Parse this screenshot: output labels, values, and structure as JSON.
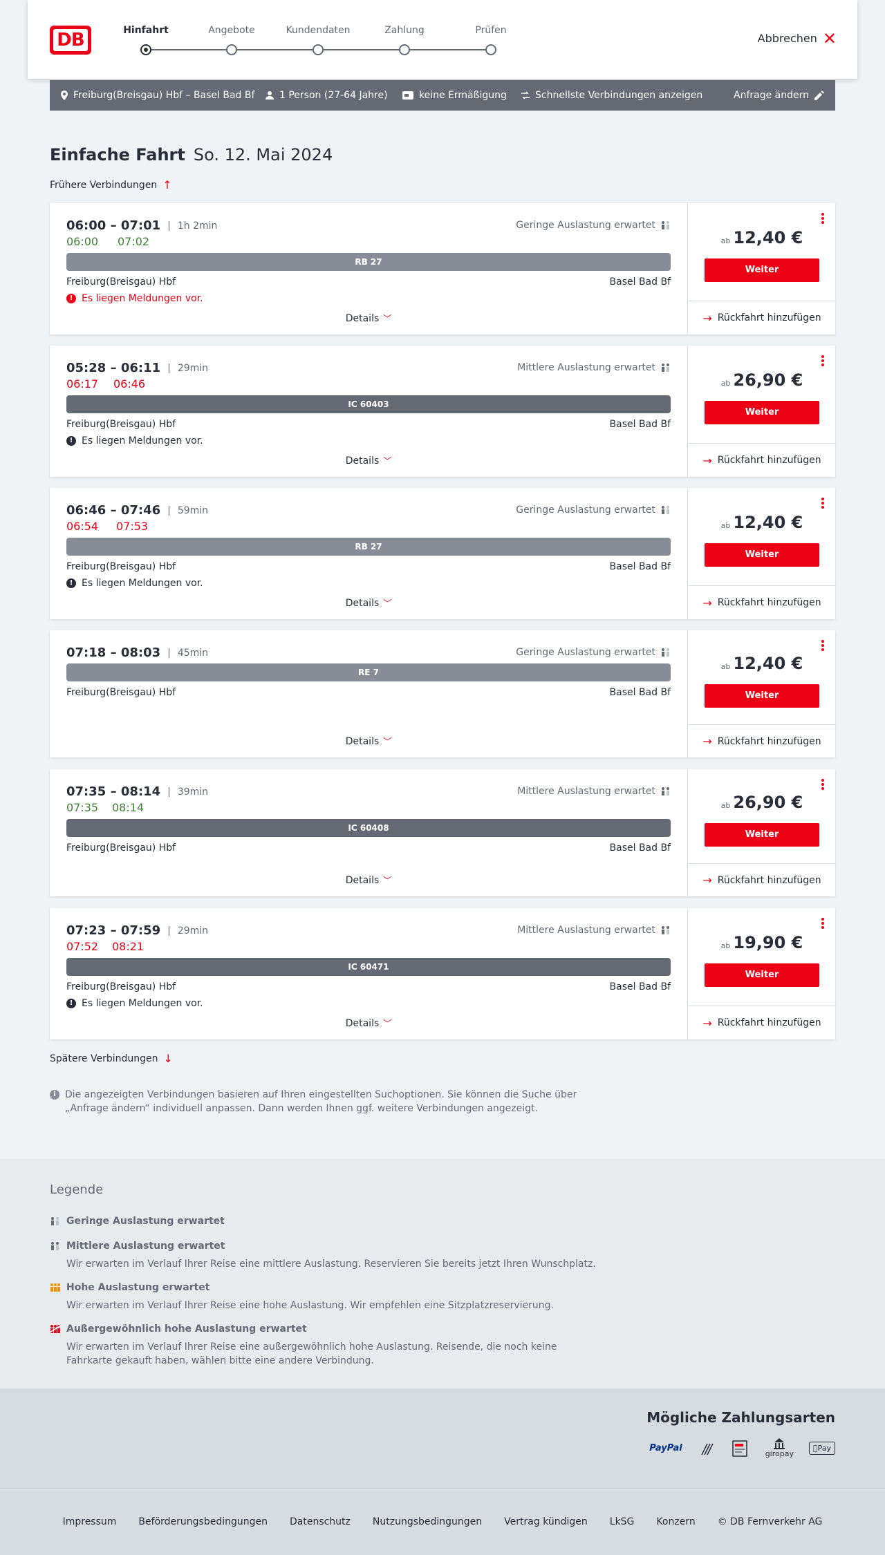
{
  "header": {
    "logo": "DB",
    "steps": [
      "Hinfahrt",
      "Angebote",
      "Kundendaten",
      "Zahlung",
      "Prüfen"
    ],
    "cancel_label": "Abbrechen"
  },
  "request": {
    "route": "Freiburg(Breisgau) Hbf – Basel Bad Bf",
    "persons": "1 Person (27-64 Jahre)",
    "discount": "keine Ermäßigung",
    "fastest": "Schnellste Verbindungen anzeigen",
    "change": "Anfrage ändern"
  },
  "title": {
    "main": "Einfache Fahrt",
    "date": "So. 12. Mai 2024"
  },
  "earlier_label": "Frühere Verbindungen",
  "later_label": "Spätere Verbindungen",
  "connections": [
    {
      "times": "06:00 – 07:01",
      "duration": "1h 2min",
      "rt_dep": "06:00",
      "rt_arr": "07:02",
      "rt_color": "green",
      "load": "Geringe Auslastung erwartet",
      "train": "RB 27",
      "from": "Freiburg(Breisgau) Hbf",
      "to": "Basel Bad Bf",
      "message": "Es liegen Meldungen vor.",
      "msg_color": "red",
      "details": "Details",
      "price_prefix": "ab",
      "price": "12,40 €",
      "button": "Weiter",
      "return": "Rückfahrt hinzufügen"
    },
    {
      "times": "05:28 – 06:11",
      "duration": "29min",
      "rt_dep": "06:17",
      "rt_arr": "06:46",
      "rt_color": "red",
      "load": "Mittlere Auslastung erwartet",
      "train": "IC 60403",
      "from": "Freiburg(Breisgau) Hbf",
      "to": "Basel Bad Bf",
      "message": "Es liegen Meldungen vor.",
      "msg_color": "black",
      "details": "Details",
      "price_prefix": "ab",
      "price": "26,90 €",
      "button": "Weiter",
      "return": "Rückfahrt hinzufügen"
    },
    {
      "times": "06:46 – 07:46",
      "duration": "59min",
      "rt_dep": "06:54",
      "rt_arr": "07:53",
      "rt_color": "red",
      "load": "Geringe Auslastung erwartet",
      "train": "RB 27",
      "from": "Freiburg(Breisgau) Hbf",
      "to": "Basel Bad Bf",
      "message": "Es liegen Meldungen vor.",
      "msg_color": "black",
      "details": "Details",
      "price_prefix": "ab",
      "price": "12,40 €",
      "button": "Weiter",
      "return": "Rückfahrt hinzufügen"
    },
    {
      "times": "07:18 – 08:03",
      "duration": "45min",
      "load": "Geringe Auslastung erwartet",
      "train": "RE 7",
      "from": "Freiburg(Breisgau) Hbf",
      "to": "Basel Bad Bf",
      "details": "Details",
      "price_prefix": "ab",
      "price": "12,40 €",
      "button": "Weiter",
      "return": "Rückfahrt hinzufügen"
    },
    {
      "times": "07:35 – 08:14",
      "duration": "39min",
      "rt_dep": "07:35",
      "rt_arr": "08:14",
      "rt_color": "green",
      "load": "Mittlere Auslastung erwartet",
      "train": "IC 60408",
      "from": "Freiburg(Breisgau) Hbf",
      "to": "Basel Bad Bf",
      "details": "Details",
      "price_prefix": "ab",
      "price": "26,90 €",
      "button": "Weiter",
      "return": "Rückfahrt hinzufügen"
    },
    {
      "times": "07:23 – 07:59",
      "duration": "29min",
      "rt_dep": "07:52",
      "rt_arr": "08:21",
      "rt_color": "red",
      "load": "Mittlere Auslastung erwartet",
      "train": "IC 60471",
      "from": "Freiburg(Breisgau) Hbf",
      "to": "Basel Bad Bf",
      "message": "Es liegen Meldungen vor.",
      "msg_color": "black",
      "details": "Details",
      "price_prefix": "ab",
      "price": "19,90 €",
      "button": "Weiter",
      "return": "Rückfahrt hinzufügen"
    }
  ],
  "info_text": "Die angezeigten Verbindungen basieren auf Ihren eingestellten Suchoptionen. Sie können die Suche über „Anfrage ändern“ individuell anpassen. Dann werden Ihnen ggf. weitere Verbindungen angezeigt.",
  "legend": {
    "title": "Legende",
    "items": [
      {
        "title": "Geringe Auslastung erwartet",
        "desc": ""
      },
      {
        "title": "Mittlere Auslastung erwartet",
        "desc": "Wir erwarten im Verlauf Ihrer Reise eine mittlere Auslastung. Reservieren Sie bereits jetzt Ihren Wunschplatz."
      },
      {
        "title": "Hohe Auslastung erwartet",
        "desc": "Wir erwarten im Verlauf Ihrer Reise eine hohe Auslastung. Wir empfehlen eine Sitzplatzreservierung."
      },
      {
        "title": "Außergewöhnlich hohe Auslastung erwartet",
        "desc": "Wir erwarten im Verlauf Ihrer Reise eine außergewöhnlich hohe Auslastung. Reisende, die noch keine Fahrkarte gekauft haben, wählen bitte eine andere Verbindung."
      }
    ]
  },
  "payment": {
    "title": "Mögliche Zahlungsarten",
    "methods": [
      "PayPal",
      "giropay",
      "Pay"
    ]
  },
  "footer": {
    "links": [
      "Impressum",
      "Beförderungsbedingungen",
      "Datenschutz",
      "Nutzungsbedingungen",
      "Vertrag kündigen",
      "LkSG",
      "Konzern",
      "© DB Fernverkehr AG"
    ]
  },
  "colors": {
    "accent": "#ec0016",
    "on_time": "#408335",
    "bar_dark": "#646973",
    "bar_light": "#878c96"
  }
}
